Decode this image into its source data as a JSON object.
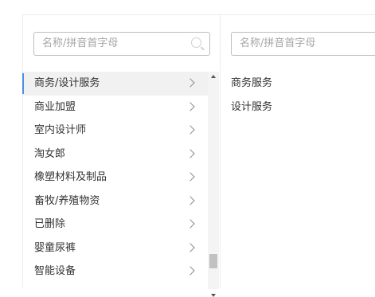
{
  "left_panel": {
    "search_placeholder": "名称/拼音首字母",
    "items": [
      {
        "label": "商务/设计服务",
        "selected": true
      },
      {
        "label": "商业加盟"
      },
      {
        "label": "室内设计师"
      },
      {
        "label": "淘女郎"
      },
      {
        "label": "橡塑材料及制品"
      },
      {
        "label": "畜牧/养殖物资"
      },
      {
        "label": "已删除"
      },
      {
        "label": "婴童尿裤"
      },
      {
        "label": "智能设备"
      }
    ]
  },
  "right_panel": {
    "search_placeholder": "名称/拼音首字母",
    "items": [
      {
        "label": "商务服务"
      },
      {
        "label": "设计服务"
      }
    ]
  },
  "colors": {
    "selected_bg": "#f1f1f1",
    "selected_accent": "#4a90e2",
    "text": "#333333",
    "placeholder": "#a6a6a6"
  }
}
